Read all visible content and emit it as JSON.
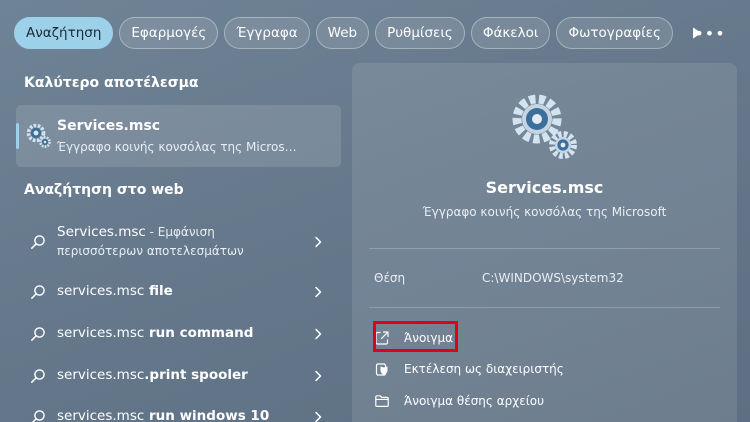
{
  "tabs": [
    {
      "label": "Αναζήτηση",
      "active": true
    },
    {
      "label": "Εφαρμογές"
    },
    {
      "label": "Έγγραφα"
    },
    {
      "label": "Web"
    },
    {
      "label": "Ρυθμίσεις"
    },
    {
      "label": "Φάκελοι"
    },
    {
      "label": "Φωτογραφίες"
    }
  ],
  "tab_more_label": "•••",
  "best_match": {
    "section_title": "Καλύτερο αποτέλεσμα",
    "title": "Services.msc",
    "subtitle": "Έγγραφο κοινής κονσόλας της Micros…"
  },
  "web": {
    "section_title": "Αναζήτηση στο web",
    "items": [
      {
        "query": "Services.msc",
        "extra_line1": " - Εμφάνιση",
        "extra_line2": "περισσότερων αποτελεσμάτων"
      },
      {
        "query_prefix": "services.msc",
        "query_suffix": " file"
      },
      {
        "query_prefix": "services.msc",
        "query_suffix": " run command"
      },
      {
        "query_prefix": "services.msc",
        "query_suffix": ".print spooler"
      },
      {
        "query_prefix": "services.msc",
        "query_suffix": " run windows 10"
      }
    ]
  },
  "details": {
    "title": "Services.msc",
    "subtitle": "Έγγραφο κοινής κονσόλας της Microsoft",
    "location_label": "Θέση",
    "location_value": "C:\\WINDOWS\\system32",
    "actions": [
      {
        "label": "Άνοιγμα",
        "icon": "open-external-icon"
      },
      {
        "label": "Εκτέλεση ως διαχειριστής",
        "icon": "run-as-admin-icon"
      },
      {
        "label": "Άνοιγμα θέσης αρχείου",
        "icon": "folder-icon"
      }
    ]
  },
  "colors": {
    "accent": "#9dd0e9",
    "highlight": "#e10014"
  }
}
